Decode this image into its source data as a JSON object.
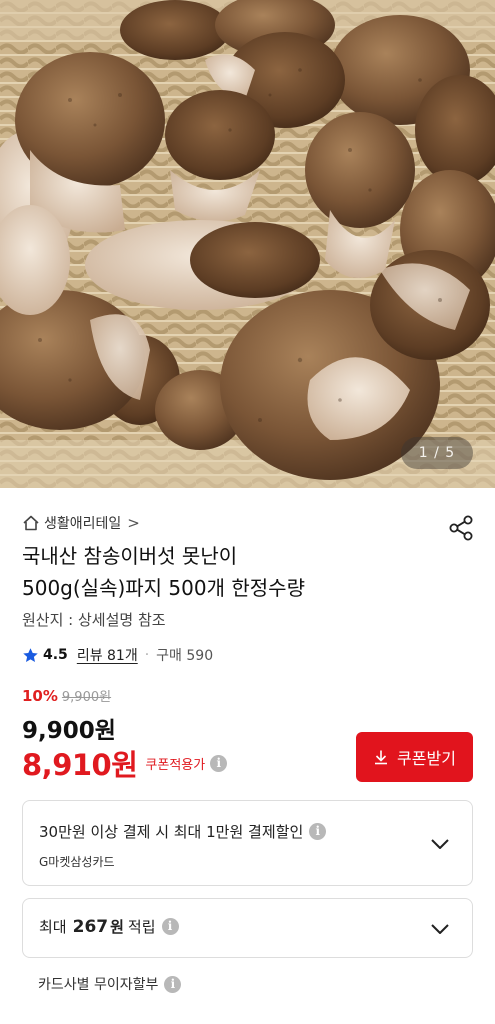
{
  "gallery": {
    "counter": "1 / 5"
  },
  "store": {
    "name": "생활애리테일",
    "chevron": ">"
  },
  "product": {
    "title_line1": "국내산 참송이버섯 못난이",
    "title_line2": "500g(실속)파지 500개 한정수량",
    "origin": "원산지 : 상세설명 참조"
  },
  "rating": {
    "score": "4.5",
    "reviews": "리뷰 81개",
    "separator": "·",
    "purchases": "구매 590"
  },
  "pricing": {
    "discount_pct": "10%",
    "original_price": "9,900원",
    "price": "9,900원",
    "coupon_price": "8,910원",
    "coupon_label": "쿠폰적용가",
    "coupon_button": "쿠폰받기"
  },
  "benefits": {
    "card_discount": "30만원 이상 결제 시 최대 1만원 결제할인",
    "card_name": "G마켓삼성카드",
    "points_prefix": "최대",
    "points_amount": "267",
    "points_unit": "원",
    "points_suffix": "적립",
    "installment": "카드사별 무이자할부"
  },
  "icons": {
    "home": "home-icon",
    "share": "share-icon",
    "star": "star-icon",
    "info": "info-icon",
    "download": "download-icon",
    "chevron_down": "chevron-down-icon"
  },
  "colors": {
    "accent_red": "#e1141d",
    "star_blue": "#1a5be0"
  }
}
